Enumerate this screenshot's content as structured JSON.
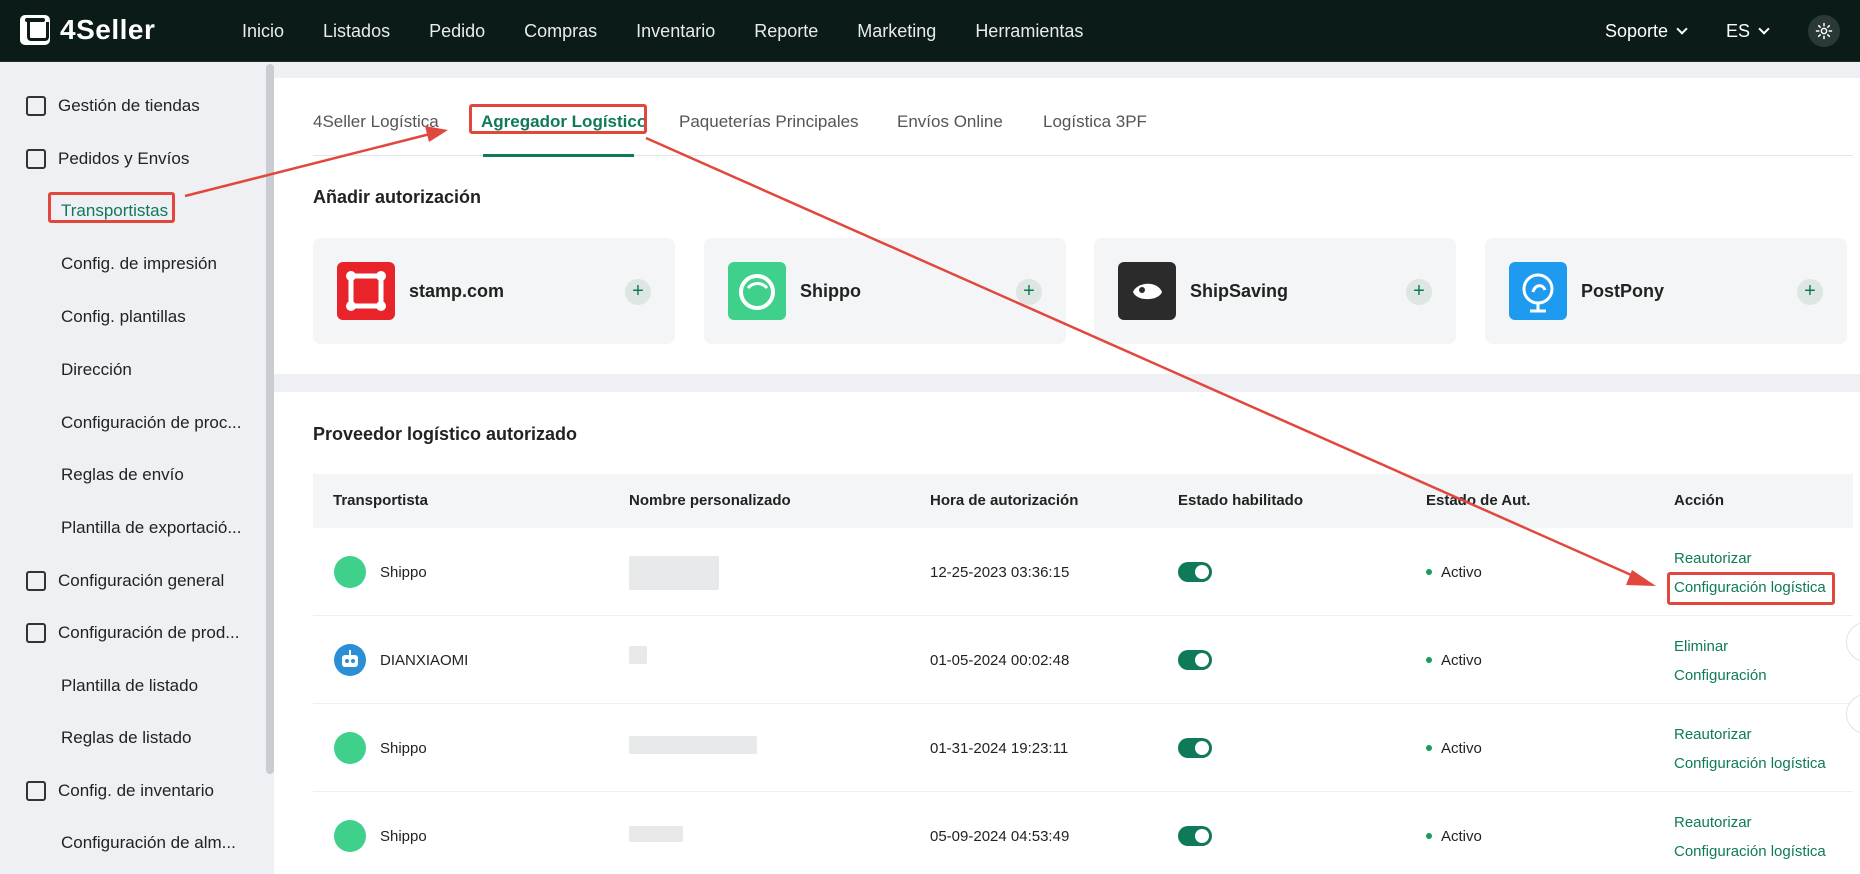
{
  "brand": {
    "name": "4Seller"
  },
  "topnav": {
    "items": [
      "Inicio",
      "Listados",
      "Pedido",
      "Compras",
      "Inventario",
      "Reporte",
      "Marketing",
      "Herramientas"
    ],
    "support": "Soporte",
    "language": "ES"
  },
  "sidebar": {
    "items": [
      {
        "label": "Gestión de tiendas",
        "icon": "store-icon"
      },
      {
        "label": "Pedidos y Envíos",
        "icon": "clipboard-icon"
      },
      {
        "label": "Transportistas",
        "sub": true,
        "active": true
      },
      {
        "label": "Config. de impresión",
        "sub": true
      },
      {
        "label": "Config. plantillas",
        "sub": true
      },
      {
        "label": "Dirección",
        "sub": true
      },
      {
        "label": "Configuración de proc...",
        "sub": true
      },
      {
        "label": "Reglas de envío",
        "sub": true
      },
      {
        "label": "Plantilla de exportació...",
        "sub": true
      },
      {
        "label": "Configuración general",
        "icon": "settings-doc-icon"
      },
      {
        "label": "Configuración de prod...",
        "icon": "upload-box-icon"
      },
      {
        "label": "Plantilla de listado",
        "sub": true
      },
      {
        "label": "Reglas de listado",
        "sub": true
      },
      {
        "label": "Config. de inventario",
        "icon": "warehouse-icon"
      },
      {
        "label": "Configuración de alm...",
        "sub": true
      }
    ]
  },
  "tabs": [
    "4Seller Logística",
    "Agregador Logístico",
    "Paqueterías Principales",
    "Envíos Online",
    "Logística 3PF"
  ],
  "auth_section": {
    "title": "Añadir autorización",
    "cards": [
      {
        "name": "stamp.com",
        "color": "#e8232a"
      },
      {
        "name": "Shippo",
        "color": "#3fd08c"
      },
      {
        "name": "ShipSaving",
        "color": "#2b2b2b"
      },
      {
        "name": "PostPony",
        "color": "#1e9bef"
      }
    ],
    "plus": "+"
  },
  "providers": {
    "title": "Proveedor logístico autorizado",
    "columns": [
      "Transportista",
      "Nombre personalizado",
      "Hora de autorización",
      "Estado habilitado",
      "Estado de Aut.",
      "Acción"
    ],
    "rows": [
      {
        "carrier": "Shippo",
        "time": "12-25-2023 03:36:15",
        "status": "Activo",
        "actions": [
          "Reautorizar",
          "Configuración logística"
        ]
      },
      {
        "carrier": "DIANXIAOMI",
        "time": "01-05-2024 00:02:48",
        "status": "Activo",
        "actions": [
          "Eliminar",
          "Configuración"
        ]
      },
      {
        "carrier": "Shippo",
        "time": "01-31-2024 19:23:11",
        "status": "Activo",
        "actions": [
          "Reautorizar",
          "Configuración logística"
        ]
      },
      {
        "carrier": "Shippo",
        "time": "05-09-2024 04:53:49",
        "status": "Activo",
        "actions": [
          "Reautorizar",
          "Configuración logística"
        ]
      }
    ]
  },
  "colors": {
    "accent": "#0f7a5a",
    "annotation": "#e2473d",
    "topbar": "#0b1b17"
  }
}
